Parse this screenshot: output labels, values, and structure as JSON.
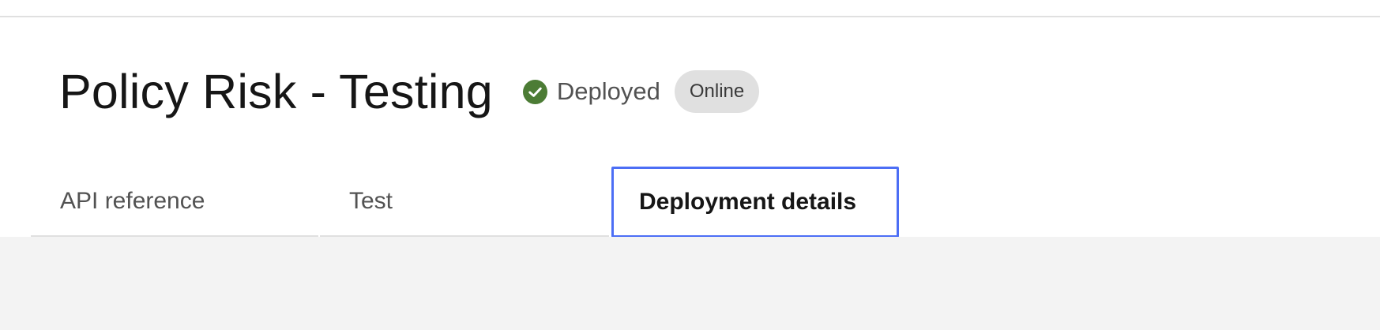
{
  "header": {
    "title": "Policy Risk - Testing",
    "status": {
      "icon": "checkmark-filled-icon",
      "label": "Deployed",
      "color": "#4c7c35"
    },
    "badge": "Online"
  },
  "tabs": [
    {
      "label": "API reference",
      "selected": false
    },
    {
      "label": "Test",
      "selected": false
    },
    {
      "label": "Deployment details",
      "selected": true
    }
  ],
  "colors": {
    "focus_outline": "#4c6ef5",
    "badge_bg": "#e0e0e0",
    "content_bg": "#f3f3f3"
  }
}
